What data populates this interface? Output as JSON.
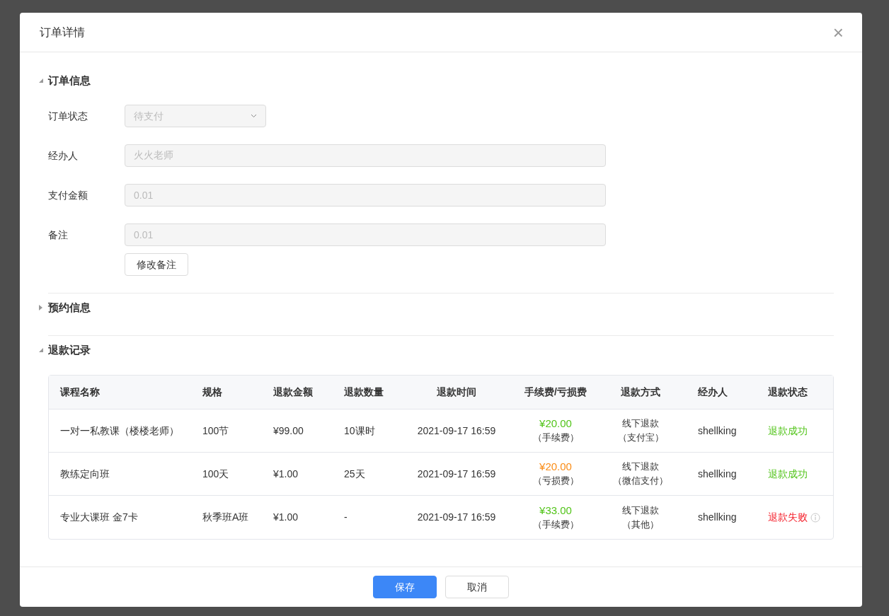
{
  "dialog": {
    "title": "订单详情",
    "close": "×"
  },
  "sections": [
    {
      "title": "订单信息",
      "expanded": true,
      "kind": "form"
    },
    {
      "title": "预约信息",
      "expanded": false
    },
    {
      "title": "退款记录",
      "expanded": true,
      "kind": "table"
    }
  ],
  "form": {
    "fields": [
      {
        "kind": "select",
        "label": "订单状态",
        "value": "待支付",
        "disabled": true
      },
      {
        "kind": "input",
        "label": "经办人",
        "value": "火火老师",
        "disabled": true
      },
      {
        "kind": "input",
        "label": "支付金额",
        "value": "0.01",
        "disabled": true
      },
      {
        "kind": "input",
        "label": "备注",
        "value": "0.01",
        "disabled": true
      }
    ],
    "edit_button": "修改备注"
  },
  "table": {
    "columns": [
      "课程名称",
      "规格",
      "退款金额",
      "退款数量",
      "退款时间",
      "手续费/亏损费",
      "退款方式",
      "经办人",
      "退款状态"
    ],
    "rows": [
      {
        "course": "一对一私教课（楼楼老师）",
        "spec": "100节",
        "amount": "¥99.00",
        "quantity": "10课时",
        "time": "2021-09-17 16:59",
        "fee": {
          "amount": "¥20.00",
          "kind": "handling",
          "note": "（手续费）"
        },
        "method": "线下退款",
        "method_note": "（支付宝）",
        "handler": "shellking",
        "status": {
          "text": "退款成功",
          "kind": "success"
        }
      },
      {
        "course": "教练定向班",
        "spec": "100天",
        "amount": "¥1.00",
        "quantity": "25天",
        "time": "2021-09-17 16:59",
        "fee": {
          "amount": "¥20.00",
          "kind": "loss",
          "note": "（亏损费）"
        },
        "method": "线下退款",
        "method_note": "（微信支付）",
        "handler": "shellking",
        "status": {
          "text": "退款成功",
          "kind": "success"
        }
      },
      {
        "course": "专业大课班 金7卡",
        "spec": "秋季班A班",
        "amount": "¥1.00",
        "quantity": "-",
        "time": "2021-09-17 16:59",
        "fee": {
          "amount": "¥33.00",
          "kind": "handling",
          "note": "（手续费）"
        },
        "method": "线下退款",
        "method_note": "（其他）",
        "handler": "shellking",
        "status": {
          "text": "退款失败",
          "kind": "failed"
        }
      }
    ]
  },
  "footer": {
    "buttons": [
      {
        "label": "保存",
        "kind": "primary"
      },
      {
        "label": "取消",
        "kind": "default"
      }
    ]
  }
}
